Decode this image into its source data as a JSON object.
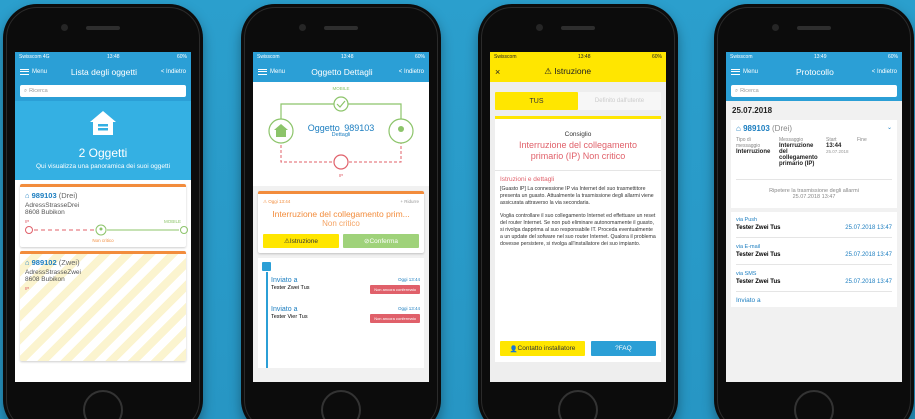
{
  "p1": {
    "status": {
      "carrier": "Swisscom 4G",
      "time": "13:48",
      "battery": "60%"
    },
    "nav": {
      "menu": "Menu",
      "title": "Lista degli oggetti",
      "back": "< Indietro"
    },
    "search": {
      "placeholder": "Ricerca"
    },
    "hero": {
      "count": "2 Oggetti",
      "text": "Qui visualizza una panoramica dei suoi oggetti"
    },
    "cards": [
      {
        "id": "989103",
        "name": "(Drei)",
        "street": "AdressStrasseDrei",
        "city": "8608 Bubikon",
        "ip": "IP",
        "mobile": "MOBILE",
        "state": "Non critico"
      },
      {
        "id": "989102",
        "name": "(Zwei)",
        "street": "AdressStrasseZwei",
        "city": "8608 Bubikon",
        "ip": "IP"
      }
    ]
  },
  "p2": {
    "status": {
      "carrier": "Swisscom",
      "time": "13:48",
      "battery": "60%"
    },
    "nav": {
      "menu": "Menu",
      "title": "Oggetto Dettagli",
      "back": "< Indietro"
    },
    "diagram": {
      "mobile": "MOBILE",
      "object": "Oggetto",
      "id": "989103",
      "details": "Dettagli",
      "ip": "IP"
    },
    "alarm": {
      "time": "Oggi 13:44",
      "reduce": "+ Ridurre",
      "title": "Interruzione del collegamento prim...",
      "state": "Non critico",
      "btn_instr": "Istruzione",
      "btn_confirm": "Conferma"
    },
    "timeline": [
      {
        "label": "Inviato a",
        "time": "Oggi 13:44",
        "who": "Tester Zwei Tus",
        "status": "Non ancora confermato"
      },
      {
        "label": "Inviato a",
        "time": "Oggi 13:44",
        "who": "Tester Vier Tus",
        "status": "Non ancora confermato"
      }
    ]
  },
  "p3": {
    "status": {
      "carrier": "Swisscom",
      "time": "13:48",
      "battery": "60%"
    },
    "nav": {
      "close": "×",
      "title": "Istruzione"
    },
    "tabs": {
      "a": "TUS",
      "b": "Definito dall'utente"
    },
    "box": {
      "kicker": "Consiglio",
      "title": "Interruzione del collegamento primario (IP) Non critico",
      "section": "Istruzioni e dettagli",
      "p1": "[Guasto IP] La connessione IP via Internet del suo trasmettitore presenta un guasto. Attualmente la trasmissione degli allarmi viene assicurata attraverso la via secondaria.",
      "p2": "Voglia controllare il suo collegamento Internet ed effettuare un reset del router Internet. Se non può eliminare autonomamente il guasto, si rivolga dapprima al suo responsabile IT. Proceda eventualmente a un update del sofware nel suo router Internet. Qualora il problema dovesse persistere, si rivolga all'installatore dei suo impianto.",
      "btn_contact": "Contatto installatore",
      "btn_faq": "FAQ"
    }
  },
  "p4": {
    "status": {
      "carrier": "Swisscom",
      "time": "13:49",
      "battery": "60%"
    },
    "nav": {
      "menu": "Menu",
      "title": "Protocollo",
      "back": "< Indietro"
    },
    "search": {
      "placeholder": "Ricerca"
    },
    "date": "25.07.2018",
    "entry": {
      "id": "989103",
      "name": "(Drei)",
      "h_type": "Tipo di messaggio",
      "h_msg": "Messaggio",
      "h_start": "Start",
      "h_end": "Fine",
      "type": "Interruzione",
      "msg": "Interruzione del collegamento primario (IP)",
      "start": "13:44",
      "start_date": "25.07.2018",
      "repeat": "Ripetere la trasmissione degli allarmi",
      "repeat_time": "25.07.2018 13:47"
    },
    "channels": [
      {
        "via": "via Push",
        "who": "Tester Zwei Tus",
        "time": "25.07.2018 13:47"
      },
      {
        "via": "via E-mail",
        "who": "Tester Zwei Tus",
        "time": "25.07.2018 13:47"
      },
      {
        "via": "via SMS",
        "who": "Tester Zwei Tus",
        "time": "25.07.2018 13:47"
      }
    ],
    "more": "Inviato a"
  },
  "colors": {
    "blue": "#2b9fd6",
    "yellow": "#ffe600",
    "orange": "#f28c3c",
    "green": "#8cc46a",
    "red": "#e0606a"
  }
}
